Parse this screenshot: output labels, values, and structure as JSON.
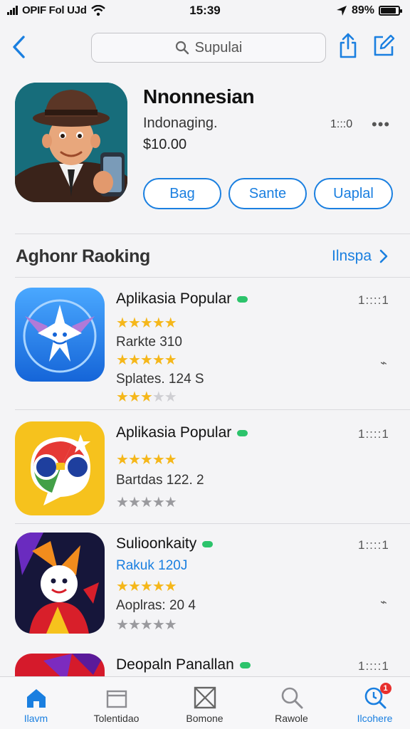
{
  "status_bar": {
    "carrier": "OPIF Fol UJd",
    "time": "15:39",
    "battery": "89%",
    "battery_level": 0.89
  },
  "nav": {
    "back_icon": "chevron-left-icon",
    "search_placeholder": "Supulai",
    "share_icon": "share-icon",
    "edit_icon": "compose-icon"
  },
  "app": {
    "title": "Nnonnesian",
    "subtitle": "Indonaging.",
    "price": "$10.00",
    "meta": "1:::0",
    "more": "•••",
    "buttons": [
      "Bag",
      "Sante",
      "Uaplal"
    ]
  },
  "section": {
    "title": "Aghonr Raoking",
    "link": "Ilnspa"
  },
  "list": [
    {
      "title": "Aplikasia Popular",
      "num": "1::::1",
      "lines": [
        "Rarkte 310",
        "Splates. 124 S"
      ],
      "ratings": [
        4.5,
        4.5,
        3
      ],
      "download_icon": "cloud-download-icon",
      "download": "⌁",
      "accent": "#2d8ef0"
    },
    {
      "title": "Aplikasia Popular",
      "num": "1::::1",
      "lines": [
        "Bartdas 122. 2"
      ],
      "ratings": [
        4.5,
        0
      ],
      "download_icon": "",
      "download": "",
      "accent": "#f6c21d"
    },
    {
      "title": "Sulioonkaity",
      "num": "1::::1",
      "lines": [
        "Rakuk 120J",
        "Aoplras: 20 4"
      ],
      "ratings": [
        4.5,
        0
      ],
      "download_icon": "cloud-download-icon",
      "download": "⌁",
      "accent": "#1b1b3a"
    },
    {
      "title": "Deopaln Panallan",
      "num": "1::::1",
      "lines": [],
      "ratings": [],
      "download_icon": "",
      "download": "",
      "accent": "#d51a2b"
    }
  ],
  "tabs": [
    {
      "label": "Ilavm",
      "icon": "home-icon",
      "active": true
    },
    {
      "label": "Tolentidao",
      "icon": "box-icon",
      "active": false
    },
    {
      "label": "Bomone",
      "icon": "crossed-box-icon",
      "active": false
    },
    {
      "label": "Rawole",
      "icon": "search-icon",
      "active": false
    },
    {
      "label": "Ilcohere",
      "icon": "search-badge-icon",
      "active": true,
      "badge": "1"
    }
  ]
}
